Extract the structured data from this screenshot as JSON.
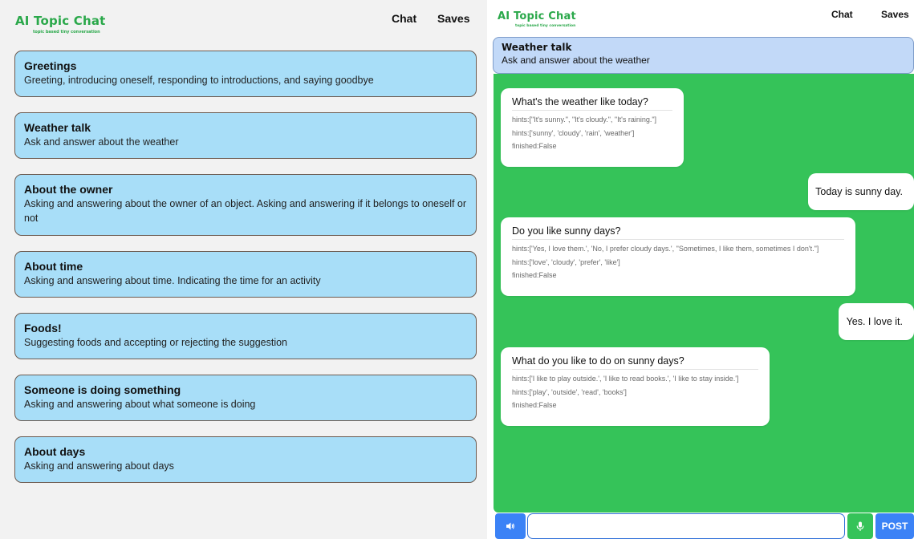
{
  "app": {
    "title": "AI Topic Chat",
    "subtitle": "topic based tiny conversation"
  },
  "nav": {
    "chat_label": "Chat",
    "saves_label": "Saves"
  },
  "topics": [
    {
      "title": "Greetings",
      "description": "Greeting, introducing oneself, responding to introductions, and saying goodbye"
    },
    {
      "title": "Weather talk",
      "description": "Ask and answer about the weather"
    },
    {
      "title": "About the owner",
      "description": "Asking and answering about the owner of an object. Asking and answering if it belongs to oneself or not"
    },
    {
      "title": "About time",
      "description": "Asking and answering about time. Indicating the time for an activity"
    },
    {
      "title": "Foods!",
      "description": "Suggesting foods and accepting or rejecting the suggestion"
    },
    {
      "title": "Someone is doing something",
      "description": "Asking and answering about what someone is doing"
    },
    {
      "title": "About days",
      "description": "Asking and answering about days"
    }
  ],
  "chat": {
    "topic_title": "Weather talk",
    "topic_description": "Ask and answer about the weather",
    "messages": [
      {
        "role": "bot",
        "text": "What's the weather like today?",
        "hints1": "hints:[\"It's sunny.\", \"It's cloudy.\", \"It's raining.\"]",
        "hints2": "hints:['sunny', 'cloudy', 'rain', 'weather']",
        "finished": "finished:False"
      },
      {
        "role": "user",
        "text": "Today is sunny day."
      },
      {
        "role": "bot",
        "text": "Do you like sunny days?",
        "hints1": "hints:['Yes, I love them.', 'No, I prefer cloudy days.', \"Sometimes, I like them, sometimes I don't.\"]",
        "hints2": "hints:['love', 'cloudy', 'prefer', 'like']",
        "finished": "finished:False"
      },
      {
        "role": "user",
        "text": "Yes. I love it."
      },
      {
        "role": "bot",
        "text": "What do you like to do on sunny days?",
        "hints1": "hints:['I like to play outside.', 'I like to read books.', 'I like to stay inside.']",
        "hints2": "hints:['play', 'outside', 'read', 'books']",
        "finished": "finished:False"
      }
    ],
    "input_value": "",
    "post_label": "POST"
  },
  "icons": {
    "speaker": "speaker-icon",
    "mic": "microphone-icon"
  },
  "colors": {
    "brand_green": "#2aa84a",
    "card_blue": "#a8def8",
    "chat_green": "#35c359",
    "banner_blue": "#c2d9f8",
    "button_blue": "#3b82f6"
  }
}
